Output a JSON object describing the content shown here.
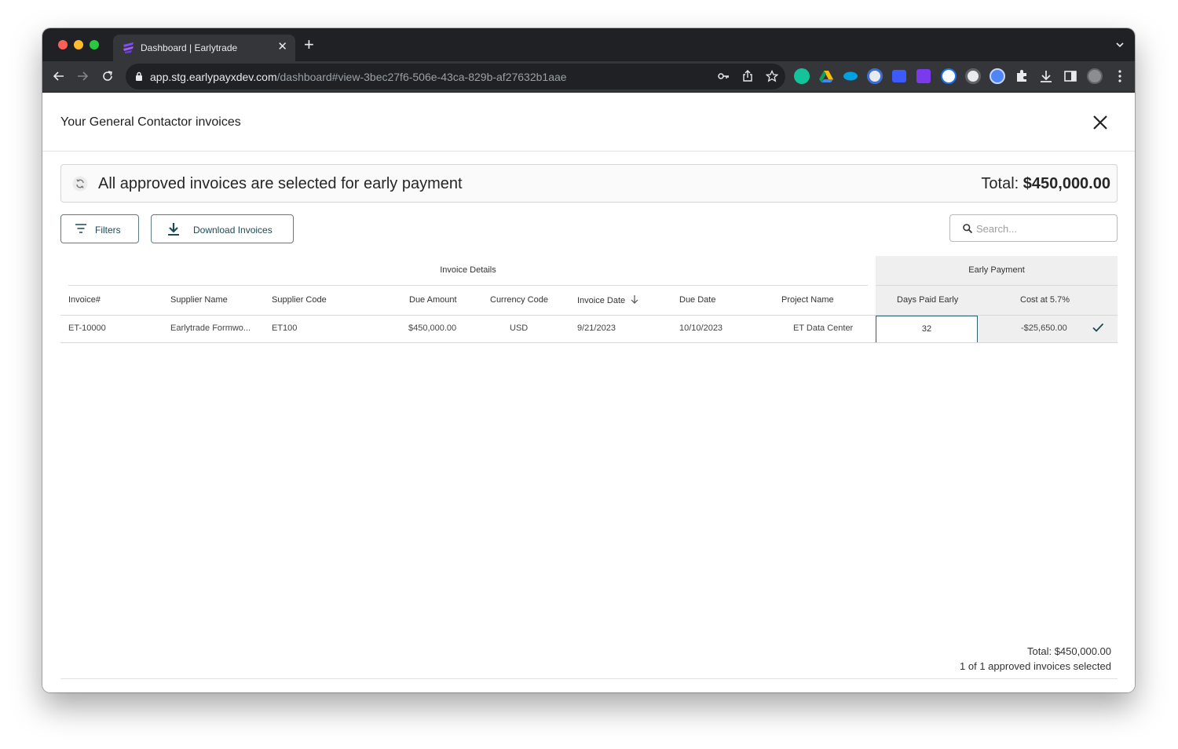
{
  "browser": {
    "tab_title": "Dashboard | Earlytrade",
    "url_host": "app.stg.earlypayxdev.com",
    "url_path": "/dashboard#view-3bec27f6-506e-43ca-829b-af27632b1aae"
  },
  "modal": {
    "title": "Your General Contactor invoices"
  },
  "banner": {
    "message": "All approved invoices are selected for early payment",
    "total_label": "Total:",
    "total_value": "$450,000.00"
  },
  "toolbar": {
    "filters_label": "Filters",
    "download_label": "Download Invoices",
    "search_placeholder": "Search..."
  },
  "table": {
    "group_invoice_details": "Invoice Details",
    "group_early_payment": "Early Payment",
    "columns": {
      "invoice_no": "Invoice#",
      "supplier_name": "Supplier Name",
      "supplier_code": "Supplier Code",
      "due_amount": "Due Amount",
      "currency_code": "Currency Code",
      "invoice_date": "Invoice Date",
      "due_date": "Due Date",
      "project_name": "Project Name",
      "days_paid_early": "Days Paid Early",
      "cost": "Cost at 5.7%"
    },
    "rows": [
      {
        "invoice_no": "ET-10000",
        "supplier_name": "Earlytrade Formwo...",
        "supplier_code": "ET100",
        "due_amount": "$450,000.00",
        "currency_code": "USD",
        "invoice_date": "9/21/2023",
        "due_date": "10/10/2023",
        "project_name": "ET Data Center",
        "days_paid_early": "32",
        "cost": "-$25,650.00"
      }
    ]
  },
  "footer": {
    "total": "Total: $450,000.00",
    "selected": "1 of 1 approved invoices selected"
  },
  "colors": {
    "accent": "#1c4a56",
    "chrome_dark": "#202124",
    "chrome_toolbar": "#35363a"
  }
}
